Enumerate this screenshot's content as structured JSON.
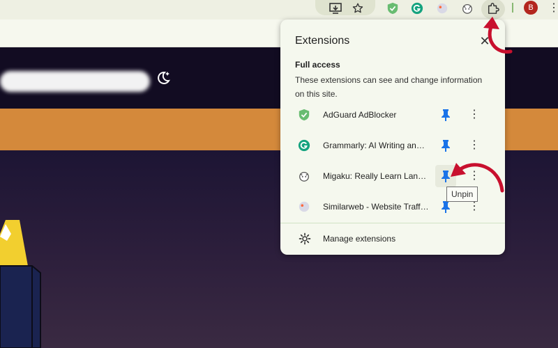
{
  "toolbar": {
    "icons": [
      "install-app-icon",
      "bookmark-star-icon",
      "adguard-icon",
      "grammarly-icon",
      "similarweb-icon",
      "migaku-icon",
      "extensions-puzzle-icon"
    ],
    "profile_initial": "B",
    "menu_glyph": "⋮"
  },
  "extensions_popup": {
    "title": "Extensions",
    "close_glyph": "✕",
    "section_title": "Full access",
    "section_description": "These extensions can see and change information on this site.",
    "items": [
      {
        "name": "AdGuard AdBlocker",
        "icon": "adguard-shield-icon",
        "pinned": true
      },
      {
        "name": "Grammarly: AI Writing and Grammar Checker App",
        "icon": "grammarly-icon",
        "pinned": true
      },
      {
        "name": "Migaku: Really Learn Languages",
        "icon": "migaku-icon",
        "pinned": true
      },
      {
        "name": "Similarweb - Website Traffic & SEO Checker",
        "icon": "similarweb-icon",
        "pinned": true
      }
    ],
    "more_glyph": "⋮",
    "manage_label": "Manage extensions"
  },
  "tooltip": {
    "text": "Unpin"
  },
  "colors": {
    "pin_blue": "#1a73e8",
    "annotation_red": "#c8102e",
    "orange_band": "#d4893b",
    "adguard_green": "#68bc71",
    "grammarly_green": "#15c39a"
  }
}
